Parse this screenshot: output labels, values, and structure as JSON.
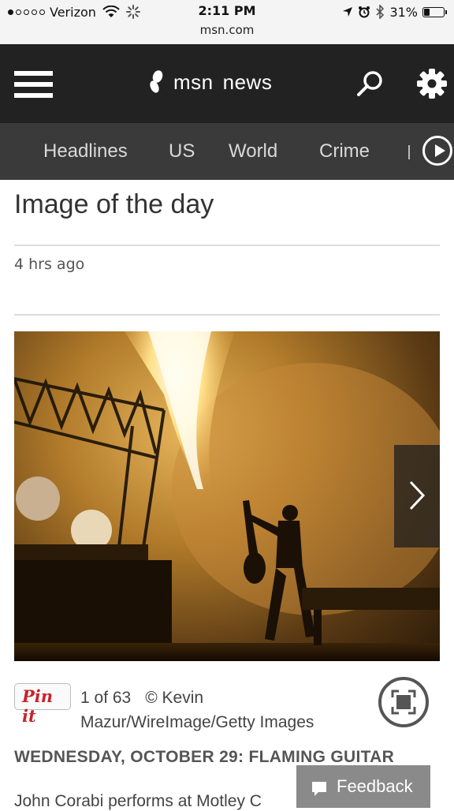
{
  "status_bar": {
    "carrier": "Verizon",
    "time": "2:11 PM",
    "url": "msn.com",
    "battery": "31%",
    "battery_level": 0.31
  },
  "header": {
    "brand_logo": "msn",
    "brand_section": "news",
    "icons": [
      "hamburger-menu-icon",
      "msn-butterfly-icon",
      "search-icon",
      "gear-icon"
    ]
  },
  "nav": {
    "tabs": [
      {
        "label": "Headlines"
      },
      {
        "label": "US"
      },
      {
        "label": "World"
      },
      {
        "label": "Crime"
      }
    ],
    "more_icon": "play-circle-icon"
  },
  "article": {
    "title": "Image of the day",
    "time_ago": "4 hrs ago",
    "slide_position": "1 of 63",
    "credit_line1": "© Kevin",
    "credit_line2": "Mazur/WireImage/Getty Images",
    "pin_label": "Pin it",
    "headline": "WEDNESDAY, OCTOBER 29: FLAMING GUITAR",
    "body_start": "John Corabi performs at Motley C"
  },
  "feedback": {
    "label": "Feedback"
  },
  "colors": {
    "header_bg": "#222222",
    "nav_bg": "#3a3a3a",
    "pin_red": "#c8232c",
    "feedback_bg": "#8a8a8a"
  }
}
